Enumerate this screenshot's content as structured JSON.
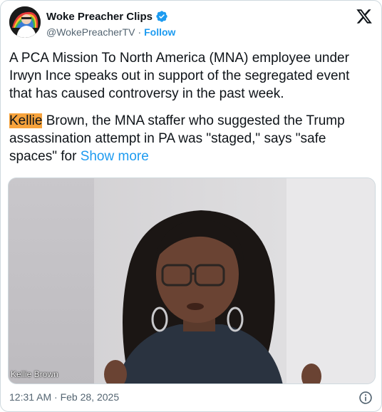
{
  "author": {
    "display_name": "Woke Preacher Clips",
    "handle": "@WokePreacherTV",
    "separator": "·",
    "follow_label": "Follow",
    "verified_color": "#1d9bf0"
  },
  "tweet": {
    "paragraph1": "A PCA Mission To North America (MNA) employee under Irwyn Ince speaks out in support of the segregated event that has caused controversy in the past week.",
    "highlight_word": "Kellie",
    "paragraph2_rest": " Brown, the MNA staffer who suggested the Trump assassination attempt in PA was \"staged,\" says \"safe spaces\" for ",
    "show_more_label": "Show more",
    "highlight_color": "#f7a33c",
    "link_color": "#1d9bf0"
  },
  "media": {
    "caption": "Kellie Brown"
  },
  "footer": {
    "timestamp": "12:31 AM · Feb 28, 2025"
  },
  "icons": {
    "logo": "x-logo-icon",
    "verified": "verified-badge-icon",
    "info": "info-icon"
  }
}
